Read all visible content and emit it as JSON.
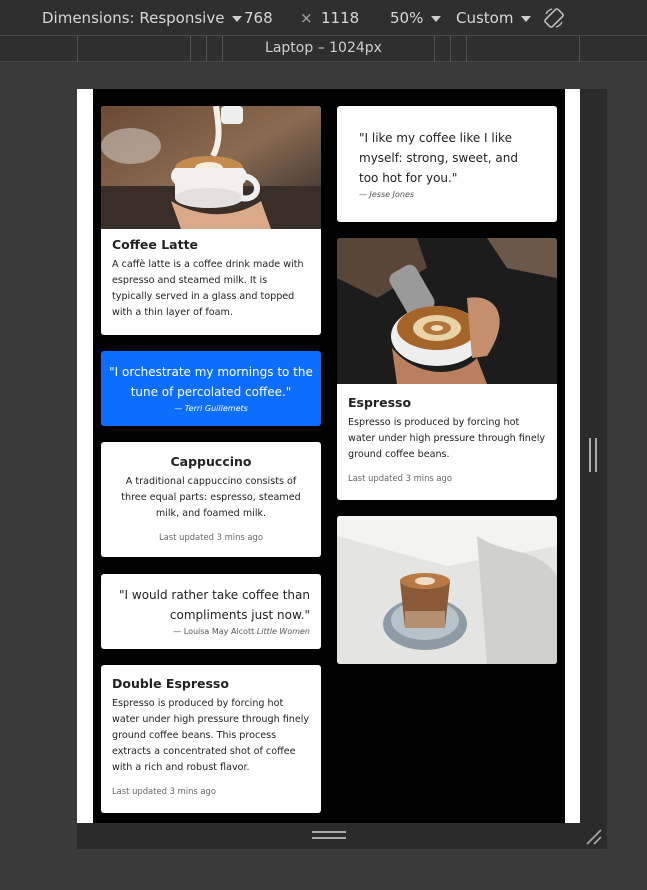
{
  "toolbar": {
    "dimensions_label": "Dimensions: Responsive",
    "width": "768",
    "times": "×",
    "height": "1118",
    "zoom": "50%",
    "throttle": "Custom",
    "rotate_icon": "rotate-icon"
  },
  "media_query_bar": {
    "label": "Laptop – 1024px"
  },
  "cards": {
    "latte": {
      "image": "coffee-latte-photo",
      "title": "Coffee Latte",
      "text": "A caffè latte is a coffee drink made with espresso and steamed milk. It is typically served in a glass and topped with a thin layer of foam."
    },
    "quote1": {
      "text": "\"I orchestrate my mornings to the tune of percolated coffee.\"",
      "dash": "—",
      "author": "Terri Guillemets"
    },
    "cappuccino": {
      "title": "Cappuccino",
      "text": "A traditional cappuccino consists of three equal parts: espresso, steamed milk, and foamed milk.",
      "updated": "Last updated 3 mins ago"
    },
    "quote2": {
      "text": "\"I would rather take coffee than compliments just now.\"",
      "dash": "—",
      "author": "Louisa May Alcott",
      "source": "Little Women"
    },
    "double_espresso": {
      "title": "Double Espresso",
      "text": "Espresso is produced by forcing hot water under high pressure through finely ground coffee beans. This process extracts a concentrated shot of coffee with a rich and robust flavor.",
      "updated": "Last updated 3 mins ago"
    },
    "quote3": {
      "text": "\"I like my coffee like I like myself: strong, sweet, and too hot for you.\"",
      "dash": "—",
      "author": "Jesse Jones"
    },
    "espresso": {
      "image": "latte-art-pour-photo",
      "title": "Espresso",
      "text": "Espresso is produced by forcing hot water under high pressure through finely ground coffee beans.",
      "updated": "Last updated 3 mins ago"
    },
    "glass": {
      "image": "coffee-glass-photo"
    }
  },
  "colors": {
    "accent": "#0d6efd",
    "toolbar_bg": "#2f2f2f",
    "page_bg": "#000000"
  }
}
